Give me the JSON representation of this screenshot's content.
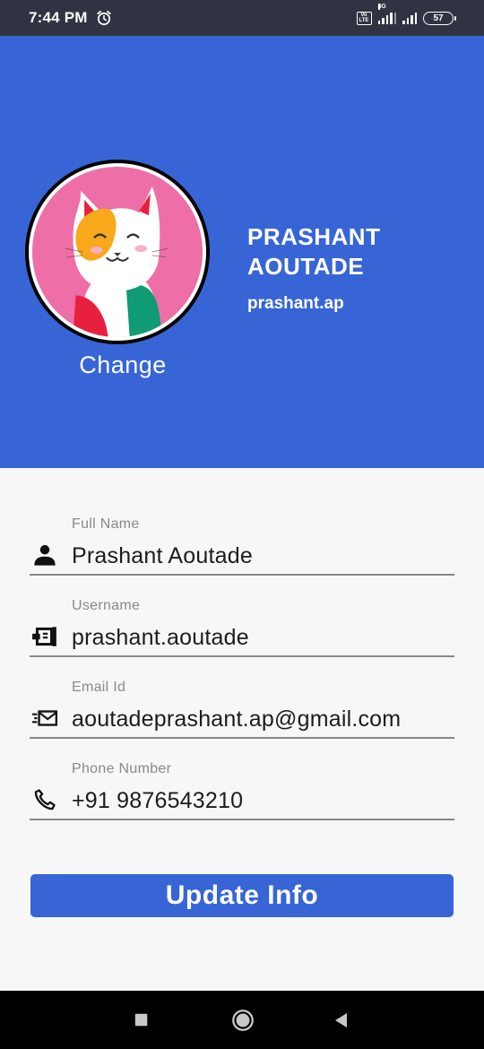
{
  "status_bar": {
    "time": "7:44 PM",
    "network_badge": "Vo LTE",
    "network_type": "4G",
    "battery": "57"
  },
  "profile": {
    "name": "PRASHANT AOUTADE",
    "username": "prashant.ap",
    "change_label": "Change"
  },
  "form": {
    "fields": [
      {
        "label": "Full Name",
        "value": "Prashant Aoutade",
        "icon": "person-icon"
      },
      {
        "label": "Username",
        "value": "prashant.aoutade",
        "icon": "id-card-icon"
      },
      {
        "label": "Email Id",
        "value": "aoutadeprashant.ap@gmail.com",
        "icon": "mail-icon"
      },
      {
        "label": "Phone Number",
        "value": "+91 9876543210",
        "icon": "phone-icon"
      }
    ],
    "submit_label": "Update Info"
  },
  "colors": {
    "primary": "#3765d6",
    "status_bar": "#2f3342",
    "background": "#f7f7f7",
    "avatar_bg": "#ee6fa7"
  },
  "nav_bar": {
    "icons": [
      "recent-apps-icon",
      "home-icon",
      "back-icon"
    ]
  }
}
